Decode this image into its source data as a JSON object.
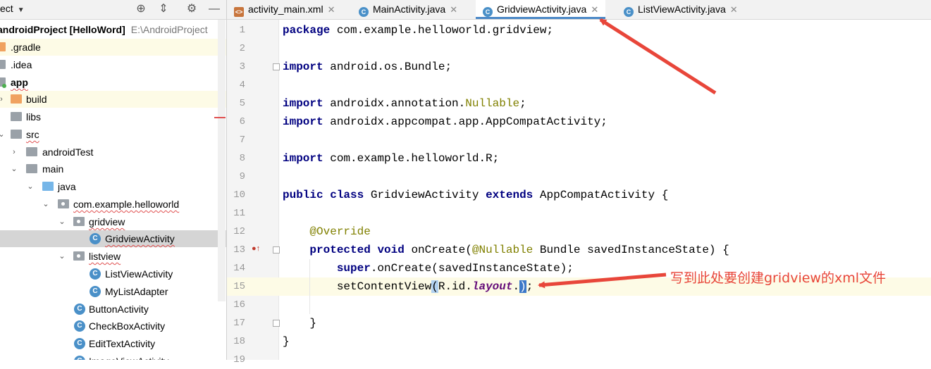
{
  "project_panel": {
    "title": "ect",
    "rows": [
      {
        "label": "androidProject [HelloWord]",
        "path": "E:\\AndroidProject",
        "icon": "folder-gray",
        "bold": true
      },
      {
        "label": ".gradle",
        "icon": "folder-orange"
      },
      {
        "label": ".idea",
        "icon": "folder-gray"
      },
      {
        "label": "app",
        "icon": "folder-gray",
        "bold": true
      },
      {
        "label": "build",
        "icon": "folder-orange"
      },
      {
        "label": "libs",
        "icon": "folder-gray"
      },
      {
        "label": "src",
        "icon": "folder-gray"
      },
      {
        "label": "androidTest",
        "icon": "folder-gray"
      },
      {
        "label": "main",
        "icon": "folder-gray"
      },
      {
        "label": "java",
        "icon": "folder-blue"
      },
      {
        "label": "com.example.helloworld",
        "icon": "folder-pkg"
      },
      {
        "label": "gridview",
        "icon": "folder-pkg"
      },
      {
        "label": "GridviewActivity",
        "icon": "class"
      },
      {
        "label": "listview",
        "icon": "folder-pkg"
      },
      {
        "label": "ListViewActivity",
        "icon": "class"
      },
      {
        "label": "MyListAdapter",
        "icon": "class"
      },
      {
        "label": "ButtonActivity",
        "icon": "class"
      },
      {
        "label": "CheckBoxActivity",
        "icon": "class"
      },
      {
        "label": "EditTextActivity",
        "icon": "class"
      },
      {
        "label": "ImageViewActivity",
        "icon": "class"
      }
    ]
  },
  "tabs": [
    {
      "label": "activity_main.xml",
      "icon": "xml-file-icon"
    },
    {
      "label": "MainActivity.java",
      "icon": "class-icon"
    },
    {
      "label": "GridviewActivity.java",
      "icon": "class-icon",
      "active": true
    },
    {
      "label": "ListViewActivity.java",
      "icon": "class-icon"
    }
  ],
  "editor": {
    "line_numbers": [
      "1",
      "2",
      "3",
      "4",
      "5",
      "6",
      "7",
      "8",
      "9",
      "10",
      "11",
      "12",
      "13",
      "14",
      "15",
      "16",
      "17",
      "18",
      "19"
    ],
    "lines": {
      "l1_kw": "package",
      "l1_rest": " com.example.helloworld.gridview;",
      "l3_kw": "import",
      "l3_rest": " android.os.Bundle;",
      "l5_kw": "import",
      "l5_mid": " androidx.annotation.",
      "l5_ann": "Nullable",
      "l5_end": ";",
      "l6_kw": "import",
      "l6_rest": " androidx.appcompat.app.AppCompatActivity;",
      "l8_kw": "import",
      "l8_rest": " com.example.helloworld.R;",
      "l10_kw1": "public",
      "l10_kw2": "class",
      "l10_name": " GridviewActivity ",
      "l10_kw3": "extends",
      "l10_rest": " AppCompatActivity {",
      "l12_ann": "@Override",
      "l13_kw1": "protected",
      "l13_kw2": "void",
      "l13_mid": " onCreate(",
      "l13_ann": "@Nullable",
      "l13_rest": " Bundle savedInstanceState) {",
      "l14_kw": "super",
      "l14_rest": ".onCreate(savedInstanceState);",
      "l15_a": "setContentView",
      "l15_paren": "(",
      "l15_b": "R.id.",
      "l15_ital": "layout",
      "l15_dot": ".",
      "l15_cursor": ")",
      "l15_end": ";",
      "l17": "}",
      "l18": "}"
    }
  },
  "annotation": {
    "text": "写到此处要创建gridview的xml文件",
    "color": "#e8463a"
  },
  "colors": {
    "keyword": "#000080",
    "annotation_code": "#808000",
    "tab_active_underline": "#4a88c7"
  }
}
